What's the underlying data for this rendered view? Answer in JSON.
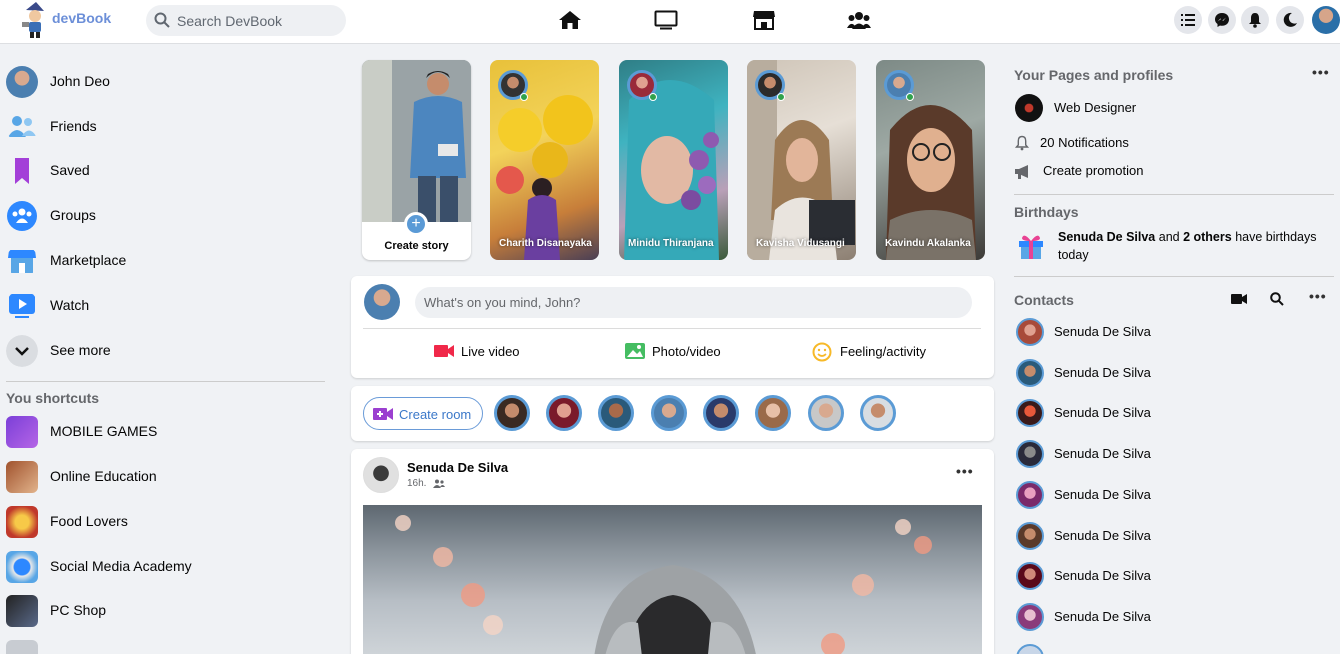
{
  "app": {
    "logo_text": "devBook"
  },
  "search": {
    "placeholder": "Search DevBook"
  },
  "topnav": {
    "icons": [
      "home-icon",
      "tv-icon",
      "store-icon",
      "groups-icon"
    ]
  },
  "topright": {
    "icons": [
      "list-icon",
      "messenger-icon",
      "bell-icon",
      "moon-icon"
    ]
  },
  "sidebar": {
    "items": [
      {
        "label": "John Deo",
        "icon": "avatar"
      },
      {
        "label": "Friends",
        "icon": "friends-icon"
      },
      {
        "label": "Saved",
        "icon": "bookmark-icon"
      },
      {
        "label": "Groups",
        "icon": "groups-icon"
      },
      {
        "label": "Marketplace",
        "icon": "store-icon"
      },
      {
        "label": "Watch",
        "icon": "play-icon"
      },
      {
        "label": "See more",
        "icon": "chevron-down-icon"
      }
    ],
    "shortcuts_title": "You shortcuts",
    "shortcuts": [
      {
        "label": "MOBILE GAMES"
      },
      {
        "label": "Online Education"
      },
      {
        "label": "Food Lovers"
      },
      {
        "label": "Social Media Academy"
      },
      {
        "label": "PC Shop"
      }
    ]
  },
  "stories": {
    "create_label": "Create story",
    "items": [
      {
        "name": "Charith Disanayaka"
      },
      {
        "name": "Minidu Thiranjana"
      },
      {
        "name": "Kavisha Vidusangi"
      },
      {
        "name": "Kavindu Akalanka"
      }
    ]
  },
  "composer": {
    "placeholder": "What's on you mind, John?",
    "actions": [
      {
        "label": "Live video",
        "icon": "video-icon",
        "color": "#f02849"
      },
      {
        "label": "Photo/video",
        "icon": "photo-icon",
        "color": "#45bd62"
      },
      {
        "label": "Feeling/activity",
        "icon": "smile-icon",
        "color": "#f7b928"
      }
    ]
  },
  "rooms": {
    "create_label": "Create room",
    "count": 8
  },
  "post": {
    "author": "Senuda De Silva",
    "time": "16h."
  },
  "right": {
    "pages_title": "Your Pages and profiles",
    "page_name": "Web Designer",
    "notifications": "20 Notifications",
    "promotion": "Create promotion",
    "birthdays_title": "Birthdays",
    "birthday_name": "Senuda De Silva",
    "birthday_and": " and ",
    "birthday_others": "2 others",
    "birthday_tail": " have birthdays today",
    "contacts_title": "Contacts",
    "contacts": [
      "Senuda De Silva",
      "Senuda De Silva",
      "Senuda De Silva",
      "Senuda De Silva",
      "Senuda De Silva",
      "Senuda De Silva",
      "Senuda De Silva",
      "Senuda De Silva"
    ]
  },
  "colors": {
    "accent": "#5b9bd5",
    "online": "#31a24c",
    "background": "#f0f2f5"
  }
}
